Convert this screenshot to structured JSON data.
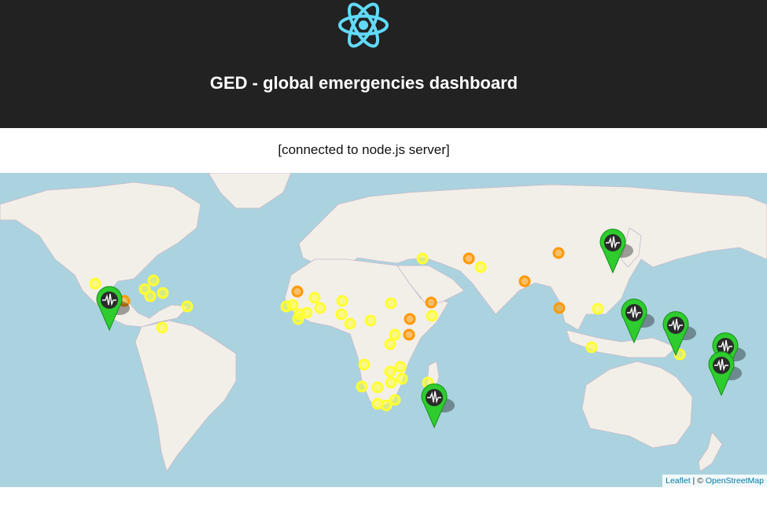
{
  "header": {
    "logo_icon": "react-atom-icon",
    "title": "GED - global emergencies dashboard",
    "background": "#222222",
    "logo_color": "#61dafb"
  },
  "status": {
    "text": "[connected to node.js server]"
  },
  "map": {
    "water_color": "#aad3df",
    "land_color": "#f2efe9",
    "attribution": {
      "leaflet_label": "Leaflet",
      "separator": " | © ",
      "osm_label": "OpenStreetMap"
    },
    "marker_colors": {
      "yellow": "#ffff33",
      "orange": "#ff9900",
      "pin": "#2ecc2e"
    },
    "earthquake_icon": "seismograph-icon"
  }
}
